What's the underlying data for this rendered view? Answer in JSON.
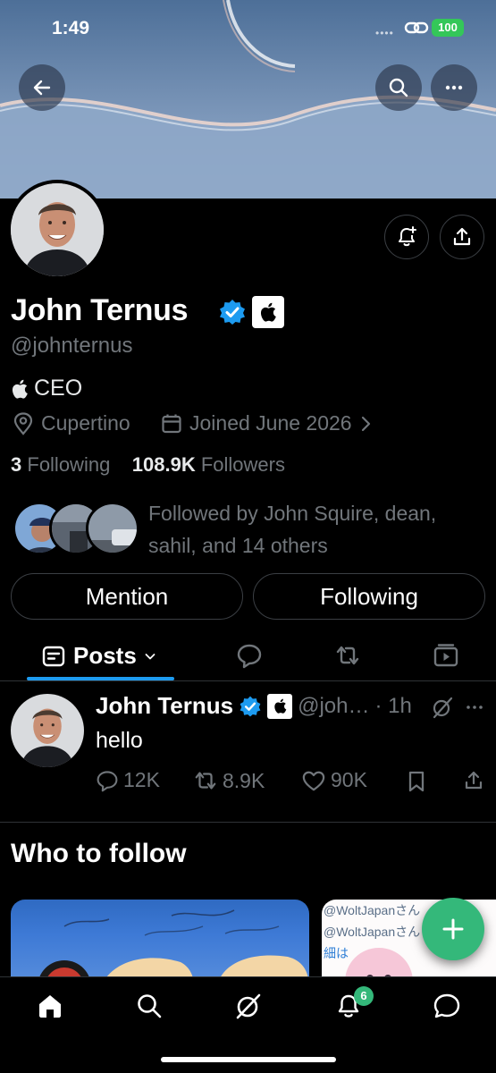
{
  "status_bar": {
    "time": "1:49",
    "battery": "100"
  },
  "profile": {
    "name": "John Ternus",
    "handle": "@johnternus",
    "bio": "CEO",
    "location": "Cupertino",
    "joined": "Joined June 2026",
    "following_count": "3",
    "following_label": "Following",
    "followers_count": "108.9K",
    "followers_label": "Followers",
    "followed_by": "Followed by John Squire, dean, sahil, and 14 others"
  },
  "buttons": {
    "mention": "Mention",
    "following": "Following"
  },
  "tabs": {
    "posts": "Posts"
  },
  "post": {
    "name": "John Ternus",
    "handle": "@joh…",
    "time": "· 1h",
    "text": "hello",
    "replies": "12K",
    "reposts": "8.9K",
    "likes": "90K"
  },
  "who_to_follow": {
    "title": "Who to follow",
    "card2_lines": [
      "@WoltJapanさん",
      "@WoltJapanさん",
      "細は"
    ]
  },
  "nav": {
    "notifications_badge": "6"
  },
  "colors": {
    "accent": "#1d9bf0",
    "fab": "#34b87a",
    "battery": "#34c759"
  },
  "icons": [
    "back-arrow-icon",
    "search-icon",
    "more-icon",
    "bell-plus-icon",
    "share-icon",
    "verified-icon",
    "apple-logo-icon",
    "location-icon",
    "calendar-icon",
    "chevron-right-icon",
    "reply-icon",
    "repost-icon",
    "like-icon",
    "bookmark-icon",
    "grok-icon",
    "plus-icon",
    "home-icon",
    "message-icon"
  ]
}
